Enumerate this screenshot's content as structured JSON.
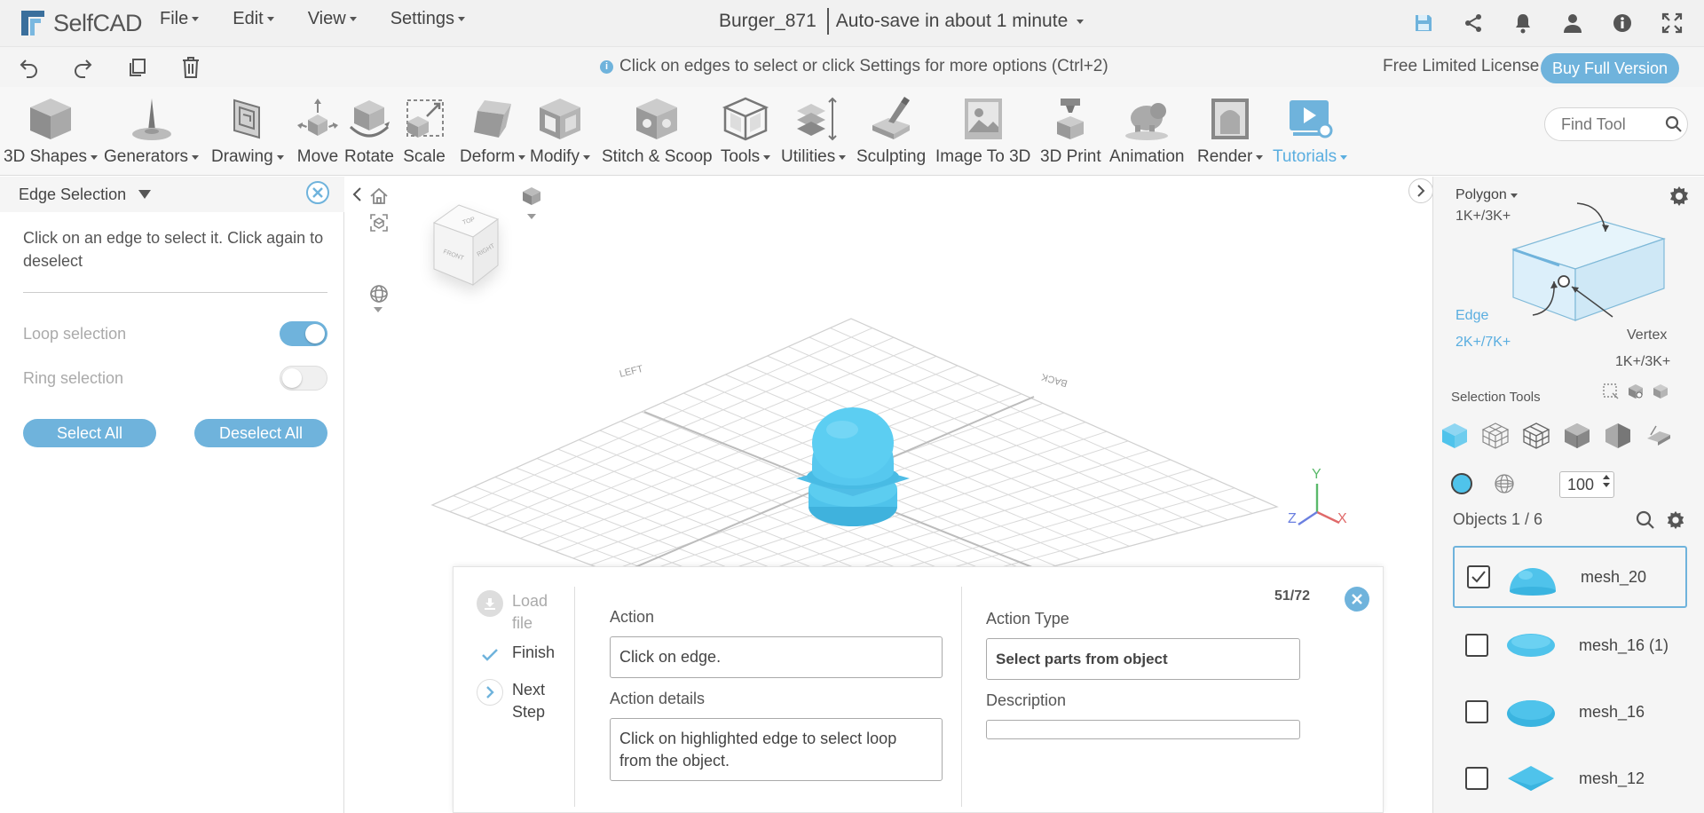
{
  "app": {
    "logo_text": "SelfCAD",
    "menus": [
      "File",
      "Edit",
      "View",
      "Settings"
    ],
    "doc_name": "Burger_871",
    "autosave": "Auto-save in about 1 minute"
  },
  "actionbar": {
    "hint": "Click on edges to select or click Settings for more options (Ctrl+2)",
    "license": "Free Limited License",
    "buy_label": "Buy Full Version"
  },
  "ribbon": {
    "tools": [
      {
        "label": "3D Shapes",
        "dropdown": true
      },
      {
        "label": "Generators",
        "dropdown": true
      },
      {
        "label": "Drawing",
        "dropdown": true
      },
      {
        "label": "Move",
        "dropdown": false
      },
      {
        "label": "Rotate",
        "dropdown": false
      },
      {
        "label": "Scale",
        "dropdown": false
      },
      {
        "label": "Deform",
        "dropdown": true
      },
      {
        "label": "Modify",
        "dropdown": true
      },
      {
        "label": "Stitch & Scoop",
        "dropdown": false
      },
      {
        "label": "Tools",
        "dropdown": true
      },
      {
        "label": "Utilities",
        "dropdown": true
      },
      {
        "label": "Sculpting",
        "dropdown": false
      },
      {
        "label": "Image To 3D",
        "dropdown": false
      },
      {
        "label": "3D Print",
        "dropdown": false
      },
      {
        "label": "Animation",
        "dropdown": false
      },
      {
        "label": "Render",
        "dropdown": true
      },
      {
        "label": "Tutorials",
        "dropdown": true
      }
    ],
    "find_placeholder": "Find Tool"
  },
  "left_panel": {
    "title": "Edge Selection",
    "description": "Click on an edge to select it. Click again to deselect",
    "loop_label": "Loop selection",
    "loop_on": true,
    "ring_label": "Ring selection",
    "ring_on": false,
    "select_all": "Select All",
    "deselect_all": "Deselect All"
  },
  "viewport": {
    "cube_labels": [
      "TOP",
      "FRONT",
      "RIGHT"
    ],
    "grid_labels": [
      "LEFT",
      "BACK"
    ],
    "axes": [
      "Y",
      "Z",
      "X"
    ]
  },
  "tutorial": {
    "steps": [
      "Load file",
      "Finish",
      "Next Step"
    ],
    "action_label": "Action",
    "action_value": "Click on edge.",
    "details_label": "Action details",
    "details_value": "Click on highlighted edge to select loop from the object.",
    "type_label": "Action Type",
    "type_value": "Select parts from object",
    "description_label": "Description",
    "description_value": "",
    "progress": "51/72"
  },
  "right_panel": {
    "polygon_label": "Polygon",
    "polygon_count": "1K+/3K+",
    "edge_label": "Edge",
    "edge_count": "2K+/7K+",
    "vertex_label": "Vertex",
    "vertex_count": "1K+/3K+",
    "selection_tools_label": "Selection Tools",
    "brush_size": "100",
    "objects_label": "Objects 1 / 6",
    "objects": [
      {
        "name": "mesh_20",
        "checked": true,
        "selected": true
      },
      {
        "name": "mesh_16 (1)",
        "checked": false,
        "selected": false
      },
      {
        "name": "mesh_16",
        "checked": false,
        "selected": false
      },
      {
        "name": "mesh_12",
        "checked": false,
        "selected": false
      }
    ]
  },
  "colors": {
    "accent": "#6fb3dc",
    "mesh": "#4fc3eb"
  }
}
